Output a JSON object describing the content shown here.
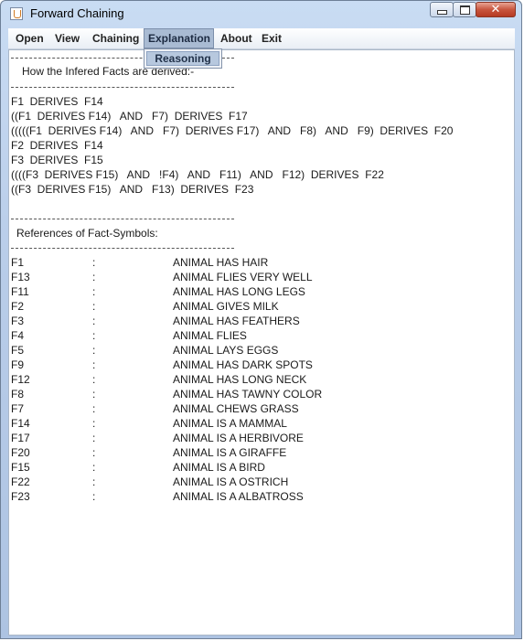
{
  "window": {
    "title": "Forward Chaining",
    "controls": {
      "minimize": "minimize-icon",
      "maximize": "maximize-icon",
      "close": "close-icon"
    }
  },
  "menu": {
    "items": [
      "Open",
      "View",
      "Chaining",
      "Explanation",
      "About",
      "Exit"
    ],
    "active": "Explanation",
    "dropdown": {
      "items": [
        "Reasoning"
      ]
    }
  },
  "content": {
    "derive_header": "How the Infered Facts are derived:-",
    "derivations": [
      "F1  DERIVES  F14",
      "((F1  DERIVES F14)   AND   F7)  DERIVES  F17",
      "(((((F1  DERIVES F14)   AND   F7)  DERIVES F17)   AND   F8)   AND   F9)  DERIVES  F20",
      "F2  DERIVES  F14",
      "F3  DERIVES  F15",
      "((((F3  DERIVES F15)   AND   !F4)   AND   F11)   AND   F12)  DERIVES  F22",
      "((F3  DERIVES F15)   AND   F13)  DERIVES  F23"
    ],
    "refs_header": "References of Fact-Symbols:",
    "refs_separator": ":",
    "references": [
      {
        "symbol": "F1",
        "description": "ANIMAL HAS HAIR"
      },
      {
        "symbol": "F13",
        "description": "ANIMAL FLIES VERY WELL"
      },
      {
        "symbol": "F11",
        "description": "ANIMAL HAS LONG LEGS"
      },
      {
        "symbol": "F2",
        "description": "ANIMAL GIVES MILK"
      },
      {
        "symbol": "F3",
        "description": "ANIMAL HAS FEATHERS"
      },
      {
        "symbol": "F4",
        "description": "ANIMAL FLIES"
      },
      {
        "symbol": "F5",
        "description": "ANIMAL LAYS EGGS"
      },
      {
        "symbol": "F9",
        "description": "ANIMAL HAS DARK SPOTS"
      },
      {
        "symbol": "F12",
        "description": "ANIMAL HAS LONG NECK"
      },
      {
        "symbol": "F8",
        "description": "ANIMAL HAS TAWNY COLOR"
      },
      {
        "symbol": "F7",
        "description": "ANIMAL CHEWS GRASS"
      },
      {
        "symbol": "F14",
        "description": "ANIMAL IS A MAMMAL"
      },
      {
        "symbol": "F17",
        "description": "ANIMAL IS A HERBIVORE"
      },
      {
        "symbol": "F20",
        "description": "ANIMAL IS A GIRAFFE"
      },
      {
        "symbol": "F15",
        "description": "ANIMAL IS A BIRD"
      },
      {
        "symbol": "F22",
        "description": "ANIMAL IS A OSTRICH"
      },
      {
        "symbol": "F23",
        "description": "ANIMAL IS A ALBATROSS"
      }
    ]
  }
}
